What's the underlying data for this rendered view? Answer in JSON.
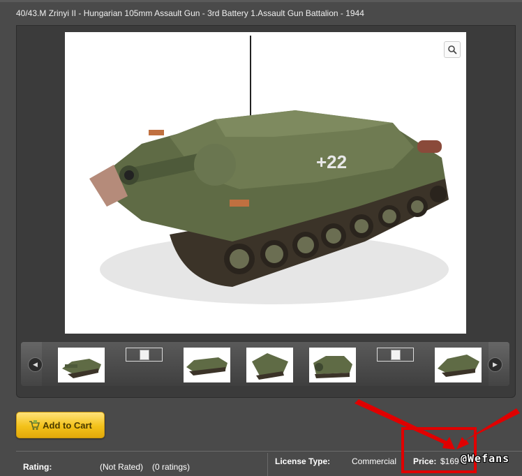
{
  "product": {
    "title": "40/43.M Zrinyi II - Hungarian 105mm Assault Gun - 3rd Battery 1.Assault Gun Battalion - 1944"
  },
  "gallery": {
    "zoom_icon": "magnifier-icon",
    "prev_icon": "arrow-left-icon",
    "next_icon": "arrow-right-icon",
    "thumbnail_count": 7,
    "broken_thumbnails": [
      2,
      6
    ]
  },
  "actions": {
    "add_to_cart_label": "Add to Cart"
  },
  "details": {
    "rating_label": "Rating:",
    "rating_value": "(Not Rated)",
    "rating_count": "(0 ratings)",
    "license_label": "License Type:",
    "license_value": "Commercial",
    "price_label": "Price:",
    "price_value": "$169"
  },
  "overlay": {
    "watermark": "@Wefans",
    "highlight_color": "#e00000"
  }
}
